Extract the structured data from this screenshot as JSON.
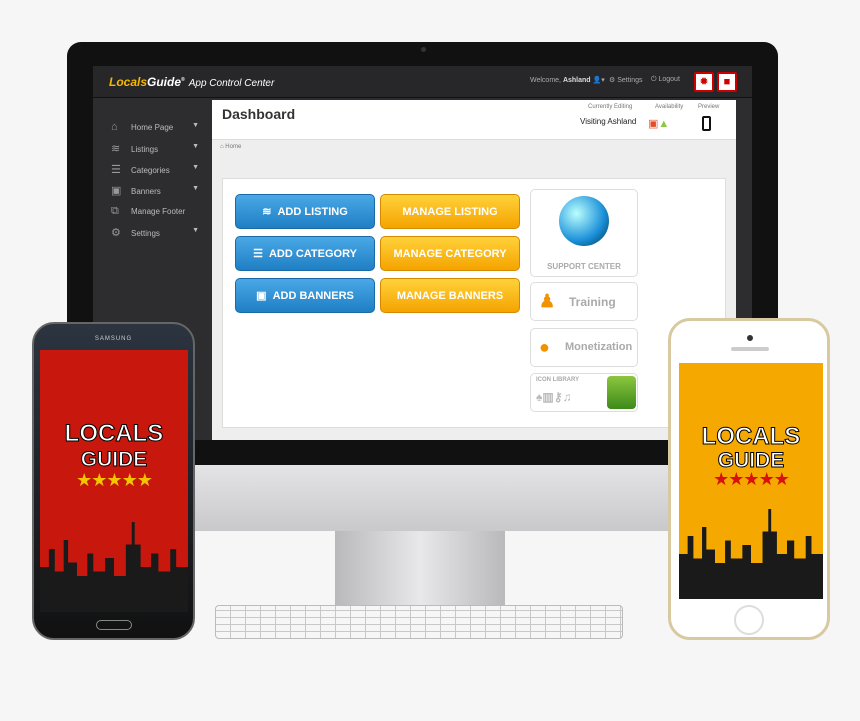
{
  "app": {
    "logo_a": "Locals",
    "logo_b": "Guide",
    "logo_tm": "®",
    "logo_sub": "App Control Center"
  },
  "topbar": {
    "welcome": "Welcome,",
    "user": "Ashland",
    "settings": "Settings",
    "logout": "Logout"
  },
  "sidebar": {
    "items": [
      {
        "label": "Home Page",
        "icon": "home-icon",
        "glyph": "⌂"
      },
      {
        "label": "Listings",
        "icon": "layers-icon",
        "glyph": "≋"
      },
      {
        "label": "Categories",
        "icon": "list-icon",
        "glyph": "☰"
      },
      {
        "label": "Banners",
        "icon": "banner-icon",
        "glyph": "▣"
      },
      {
        "label": "Manage Footer",
        "icon": "footer-icon",
        "glyph": "⧉"
      },
      {
        "label": "Settings",
        "icon": "gear-icon",
        "glyph": "⚙"
      }
    ]
  },
  "header": {
    "title": "Dashboard",
    "currently_editing_label": "Currently Editing",
    "currently_editing": "Visiting Ashland",
    "availability_label": "Availability",
    "preview_label": "Preview"
  },
  "breadcrumb": {
    "home": "Home"
  },
  "actions": {
    "add_listing": "ADD LISTING",
    "manage_listing": "MANAGE LISTING",
    "add_category": "ADD CATEGORY",
    "manage_category": "MANAGE CATEGORY",
    "add_banners": "ADD BANNERS",
    "manage_banners": "MANAGE BANNERS"
  },
  "tiles": {
    "support": "SUPPORT CENTER",
    "training": "Training",
    "monetization": "Monetization",
    "icon_library": "ICON LIBRARY"
  },
  "phones": {
    "samsung_brand": "SAMSUNG",
    "title1": "LOCALS",
    "title2": "GUIDE",
    "stars": "★★★★★"
  },
  "colors": {
    "blue": "#1f7fc4",
    "orange": "#f5a300",
    "samsung_screen": "#c8180e",
    "iphone_screen": "#f5a800"
  }
}
